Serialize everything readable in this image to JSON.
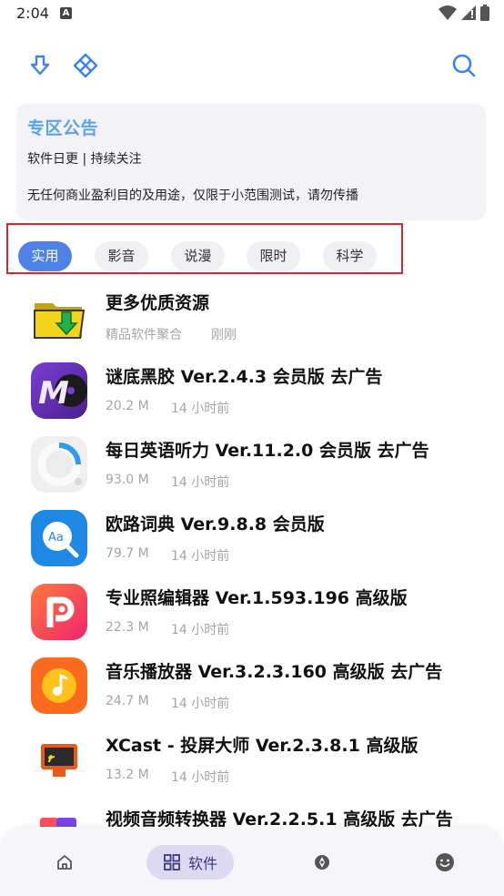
{
  "status": {
    "time": "2:04",
    "notif_icon": "A"
  },
  "toolbar": {
    "icons": [
      "download-icon",
      "diamond-icon",
      "search-icon"
    ]
  },
  "notice": {
    "title": "专区公告",
    "line1": "软件日更 | 持续关注",
    "line2": "无任何商业盈利目的及用途，仅限于小范围测试，请勿传播"
  },
  "tabs": [
    {
      "label": "实用",
      "active": true
    },
    {
      "label": "影音",
      "active": false
    },
    {
      "label": "说漫",
      "active": false
    },
    {
      "label": "限时",
      "active": false
    },
    {
      "label": "科学",
      "active": false
    }
  ],
  "apps": [
    {
      "name": "更多优质资源",
      "size": "精品软件聚合",
      "time": "刚刚"
    },
    {
      "name": "谜底黑胶 Ver.2.4.3 会员版 去广告",
      "size": "20.2 M",
      "time": "14 小时前"
    },
    {
      "name": "每日英语听力 Ver.11.2.0 会员版 去广告",
      "size": "93.0 M",
      "time": "14 小时前"
    },
    {
      "name": "欧路词典 Ver.9.8.8 会员版",
      "size": "79.7 M",
      "time": "14 小时前"
    },
    {
      "name": "专业照编辑器 Ver.1.593.196 高级版",
      "size": "22.3 M",
      "time": "14 小时前"
    },
    {
      "name": "音乐播放器 Ver.3.2.3.160 高级版 去广告",
      "size": "24.7 M",
      "time": "14 小时前"
    },
    {
      "name": "XCast - 投屏大师 Ver.2.3.8.1 高级版",
      "size": "13.2 M",
      "time": "14 小时前"
    },
    {
      "name": "视频音频转换器 Ver.2.2.5.1 高级版 去广告",
      "size": "",
      "time": ""
    }
  ],
  "bottom_nav": {
    "home_icon": "home-icon",
    "active_label": "软件",
    "discover_icon": "compass-icon",
    "me_icon": "smile-icon"
  },
  "colors": {
    "accent": "#4f82e6",
    "notice_title": "#5aa2ee",
    "highlight_box": "#d8262d"
  }
}
